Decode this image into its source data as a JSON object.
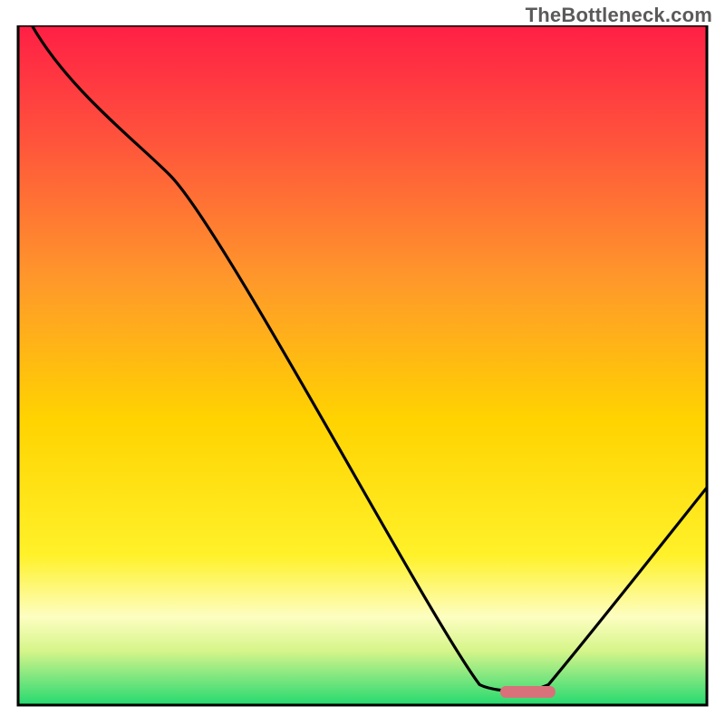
{
  "watermark": "TheBottleneck.com",
  "chart_data": {
    "type": "line",
    "title": "",
    "xlabel": "",
    "ylabel": "",
    "xlim": [
      0,
      100
    ],
    "ylim": [
      0,
      100
    ],
    "series": [
      {
        "name": "bottleneck-curve",
        "x": [
          2,
          22,
          67,
          73,
          77,
          100
        ],
        "y": [
          100,
          78,
          3,
          2,
          3,
          32
        ]
      }
    ],
    "marker": {
      "name": "optimal-marker",
      "x_start": 70,
      "x_end": 78,
      "y": 2,
      "color": "#d9717a"
    },
    "background_gradient": {
      "top_color": "#ff1f45",
      "mid_color": "#ffd300",
      "bottom_color": "#25da6f",
      "pale_band": "#fdfec1"
    }
  }
}
